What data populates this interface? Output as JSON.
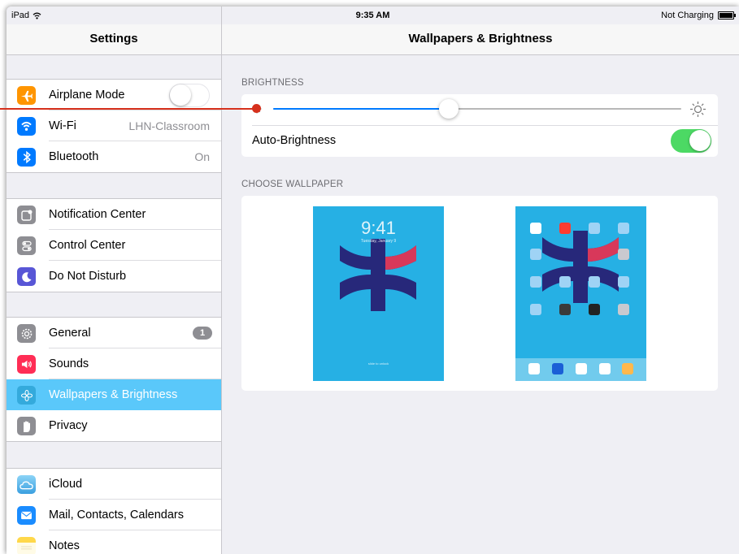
{
  "status_bar": {
    "device": "iPad",
    "time": "9:35 AM",
    "battery_text": "Not Charging"
  },
  "master": {
    "title": "Settings",
    "groups": [
      [
        {
          "label": "Airplane Mode",
          "icon": "airplane-icon",
          "icon_color": "#ff9500",
          "toggle": "off"
        },
        {
          "label": "Wi-Fi",
          "icon": "wifi-icon",
          "icon_color": "#007aff",
          "value": "LHN-Classroom"
        },
        {
          "label": "Bluetooth",
          "icon": "bluetooth-icon",
          "icon_color": "#007aff",
          "value": "On"
        }
      ],
      [
        {
          "label": "Notification Center",
          "icon": "notification-center-icon",
          "icon_color": "#8e8e93"
        },
        {
          "label": "Control Center",
          "icon": "control-center-icon",
          "icon_color": "#8e8e93"
        },
        {
          "label": "Do Not Disturb",
          "icon": "moon-icon",
          "icon_color": "#5856d6"
        }
      ],
      [
        {
          "label": "General",
          "icon": "gear-icon",
          "icon_color": "#8e8e93",
          "badge": "1"
        },
        {
          "label": "Sounds",
          "icon": "speaker-icon",
          "icon_color": "#ff2d55"
        },
        {
          "label": "Wallpapers & Brightness",
          "icon": "flower-icon",
          "icon_color": "#34aadc",
          "selected": true
        },
        {
          "label": "Privacy",
          "icon": "hand-icon",
          "icon_color": "#8e8e93"
        }
      ],
      [
        {
          "label": "iCloud",
          "icon": "cloud-icon",
          "icon_color": "#5ac8fa"
        },
        {
          "label": "Mail, Contacts, Calendars",
          "icon": "envelope-icon",
          "icon_color": "#1a8cff"
        },
        {
          "label": "Notes",
          "icon": "notes-icon",
          "icon_color": "#ffcc00"
        }
      ]
    ]
  },
  "detail": {
    "title": "Wallpapers & Brightness",
    "brightness_header": "BRIGHTNESS",
    "brightness_level": 0.43,
    "auto_brightness_label": "Auto-Brightness",
    "auto_brightness": "on",
    "wallpaper_header": "CHOOSE WALLPAPER",
    "lock_time": "9:41",
    "lock_date": "Tuesday, January 9",
    "lock_unlock": "slide to unlock"
  },
  "colors": {
    "accent": "#007aff",
    "selected_row": "#5ac8fa",
    "toggle_on": "#4cd964",
    "annotation": "#d6301c",
    "wallpaper_bg": "#26b0e4"
  }
}
